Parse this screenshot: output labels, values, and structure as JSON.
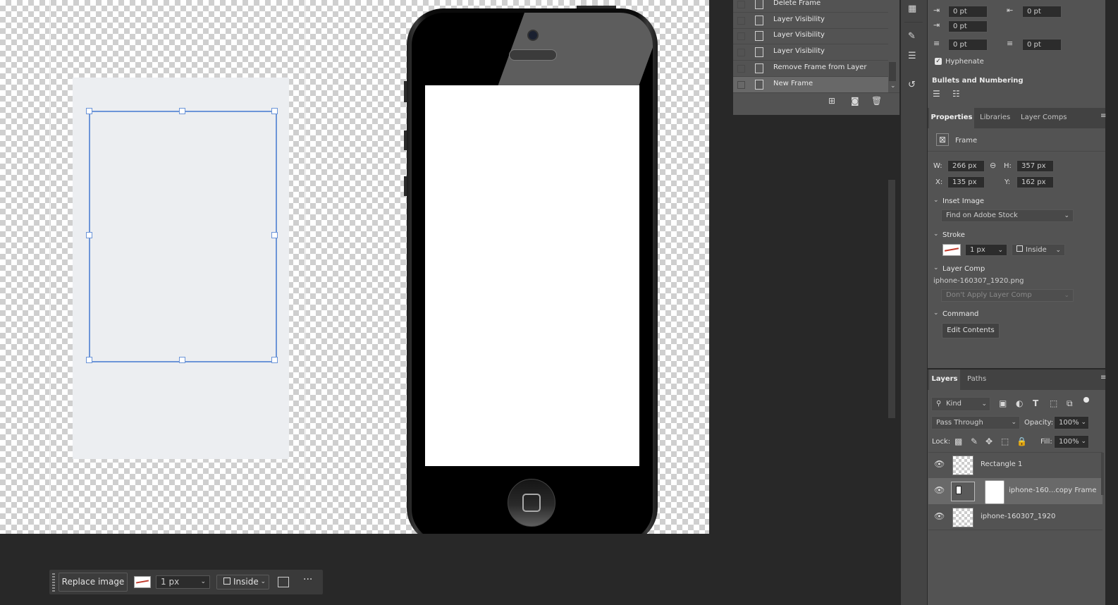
{
  "history": {
    "items": [
      {
        "label": "Delete Frame"
      },
      {
        "label": "Layer Visibility"
      },
      {
        "label": "Layer Visibility"
      },
      {
        "label": "Layer Visibility"
      },
      {
        "label": "Remove Frame from Layer"
      },
      {
        "label": "New Frame"
      }
    ],
    "selected_index": 5
  },
  "paragraph": {
    "indent_left": "0 pt",
    "indent_right": "0 pt",
    "indent_first": "0 pt",
    "space_before": "0 pt",
    "space_after": "0 pt",
    "hyphenate_label": "Hyphenate",
    "hyphenate_checked": true,
    "bullets_label": "Bullets and Numbering"
  },
  "properties": {
    "tabs": [
      "Properties",
      "Libraries",
      "Layer Comps"
    ],
    "kind_label": "Frame",
    "w_label": "W:",
    "w_value": "266 px",
    "h_label": "H:",
    "h_value": "357 px",
    "x_label": "X:",
    "x_value": "135 px",
    "y_label": "Y:",
    "y_value": "162 px",
    "inset_image_label": "Inset Image",
    "inset_image_value": "Find on Adobe Stock",
    "stroke_label": "Stroke",
    "stroke_width": "1 px",
    "stroke_align": "Inside",
    "layer_comp_label": "Layer Comp",
    "layer_comp_file": "iphone-160307_1920.png",
    "layer_comp_value": "Don't Apply Layer Comp",
    "command_label": "Command",
    "edit_contents": "Edit Contents"
  },
  "layers": {
    "tabs": [
      "Layers",
      "Paths"
    ],
    "filter_kind": "Kind",
    "blend_mode": "Pass Through",
    "opacity_label": "Opacity:",
    "opacity_value": "100%",
    "lock_label": "Lock:",
    "fill_label": "Fill:",
    "fill_value": "100%",
    "items": [
      {
        "name": "Rectangle 1"
      },
      {
        "name": "iphone-160...copy Frame"
      },
      {
        "name": "iphone-160307_1920"
      }
    ],
    "selected_index": 1
  },
  "context_bar": {
    "replace_image": "Replace image",
    "stroke_width": "1 px",
    "stroke_align": "Inside",
    "more": "···"
  },
  "colors": {
    "selection": "#6c95d8",
    "panel_bg": "#535353",
    "workspace_bg": "#282828"
  }
}
